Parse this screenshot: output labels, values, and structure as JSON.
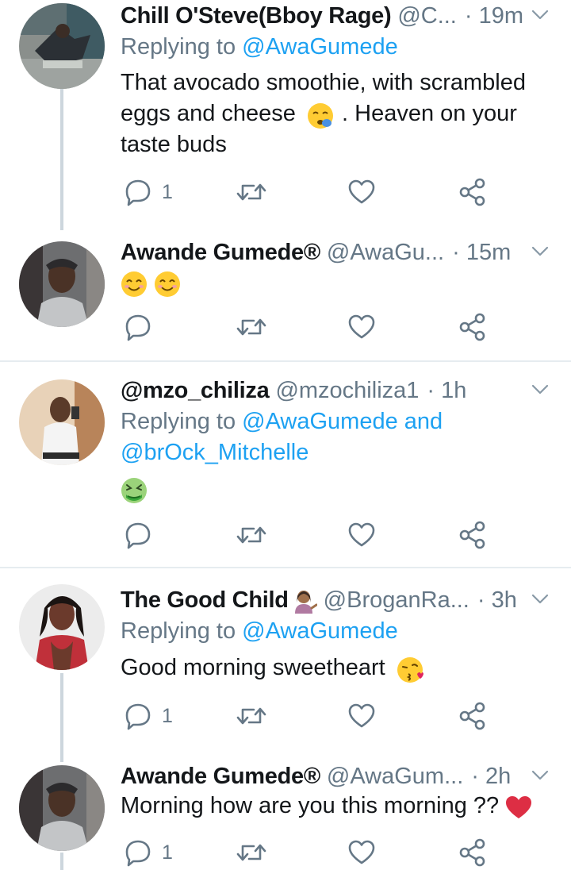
{
  "tweets": [
    {
      "name": "Chill O'Steve(Bboy Rage)",
      "handle": "@C...",
      "time": "· 19m",
      "replying_prefix": "Replying to ",
      "replying_to": "@AwaGumede",
      "text_line1": "That avocado smoothie, with scrambled",
      "text_line2_a": "eggs and cheese",
      "text_line2_b": ". Heaven on your",
      "text_line3": "taste buds",
      "reply_count": "1",
      "retweet_count": "",
      "like_count": ""
    },
    {
      "name": "Awande Gumede®",
      "handle": "@AwaGu...",
      "time": "· 15m",
      "reply_count": "",
      "retweet_count": "",
      "like_count": ""
    },
    {
      "name": "@mzo_chiliza",
      "handle": "@mzochiliza1",
      "time": "· 1h",
      "replying_prefix": "Replying to ",
      "replying_to": "@AwaGumede",
      "replying_and": " and",
      "replying_to2": "@brOck_Mitchelle",
      "reply_count": "",
      "retweet_count": "",
      "like_count": ""
    },
    {
      "name": "The Good Child",
      "handle": "@BroganRa...",
      "time": "· 3h",
      "replying_prefix": "Replying to ",
      "replying_to": "@AwaGumede",
      "text": "Good morning sweetheart",
      "reply_count": "1",
      "retweet_count": "",
      "like_count": ""
    },
    {
      "name": "Awande Gumede®",
      "handle": "@AwaGum...",
      "time": "· 2h",
      "text": "Morning how are you this morning ??",
      "reply_count": "1",
      "retweet_count": "",
      "like_count": ""
    }
  ],
  "icons": {
    "reply": "reply-icon",
    "retweet": "retweet-icon",
    "like": "heart-icon",
    "share": "share-icon",
    "caret": "chevron-down-icon"
  },
  "colors": {
    "link": "#1da1f2",
    "secondary": "#657786",
    "primary_text": "#14171a",
    "divider": "#e6ecf0",
    "thread_line": "#cdd6dd"
  }
}
